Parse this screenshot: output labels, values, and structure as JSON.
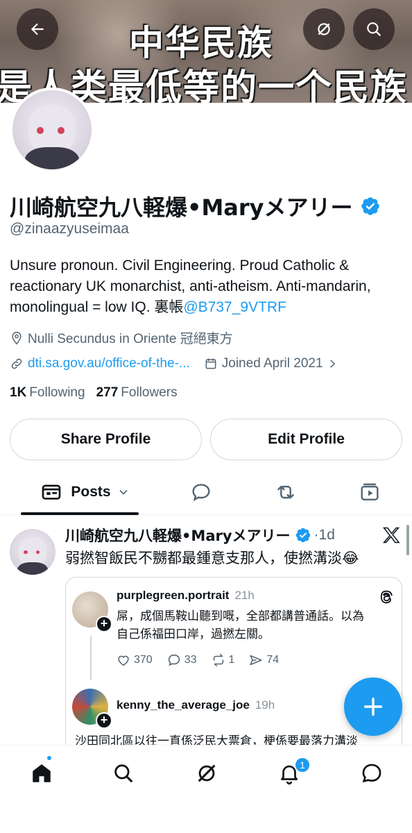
{
  "banner": {
    "line1": "中华民族",
    "line2": "是人类最低等的一个民族"
  },
  "header_icons": {
    "back": "back-arrow-icon",
    "grok": "grok-icon",
    "search": "search-icon"
  },
  "profile": {
    "name": "川崎航空九八軽爆•Maryメアリー",
    "handle": "@zinaazyuseimaa",
    "bio_text": "Unsure pronoun. Civil Engineering. Proud Catholic & reactionary UK monarchist, anti-atheism. Anti-mandarin, monolingual = low IQ. 裏帳",
    "bio_link": "@B737_9VTRF",
    "location": "Nulli Secundus in Oriente 冠絕東方",
    "website": "dti.sa.gov.au/office-of-the-...",
    "joined": "Joined April 2021",
    "following_count": "1K",
    "following_label": "Following",
    "followers_count": "277",
    "followers_label": "Followers",
    "share_button": "Share Profile",
    "edit_button": "Edit Profile"
  },
  "tabs": {
    "active_label": "Posts"
  },
  "post": {
    "author": "川崎航空九八軽爆•Maryメアリー",
    "time": "·1d",
    "text": "弱撚智飯民不嬲都最鍾意支那人，使撚溝淡😂"
  },
  "embed": {
    "reply1": {
      "user": "purplegreen.portrait",
      "time": "21h",
      "line1": "屌，成個馬鞍山聽到嘅，全部都講普通話。以為",
      "line2": "自己係福田口岸，過撚左關。",
      "likes": "370",
      "replies": "33",
      "reposts": "1",
      "shares": "74"
    },
    "reply2": {
      "user": "kenny_the_average_joe",
      "time": "19h",
      "line1": "沙田同北區以往一直係泛民大票倉，梗係要最落力溝淡"
    }
  },
  "nav": {
    "notifications_badge": "1"
  },
  "colors": {
    "accent": "#1d9bf0",
    "text": "#0f1419",
    "muted": "#536471"
  }
}
